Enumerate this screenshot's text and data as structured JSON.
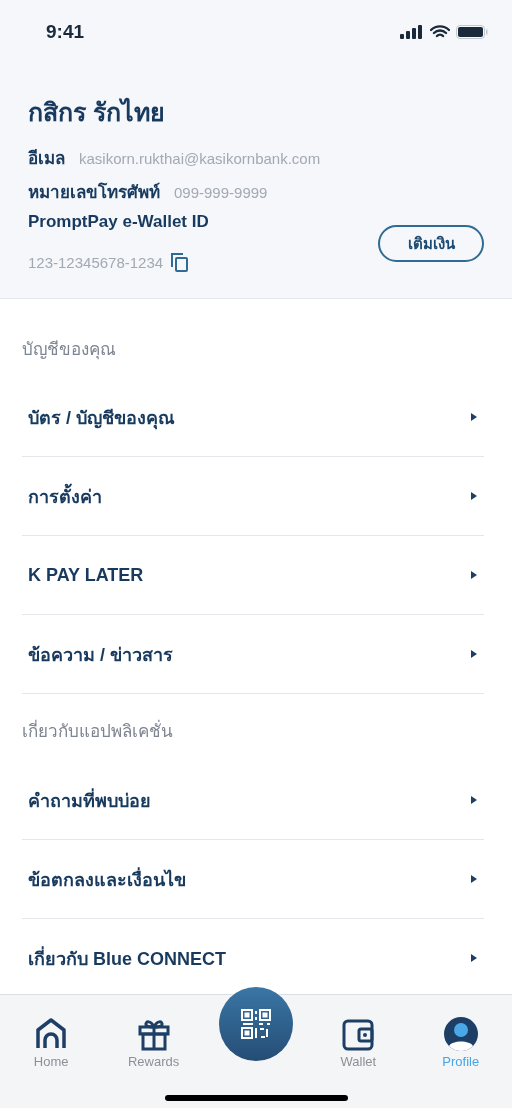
{
  "status_bar": {
    "time": "9:41"
  },
  "profile": {
    "name": "กสิกร รักไทย",
    "fields": [
      {
        "label": "อีเมล",
        "value": "kasikorn.rukthai@kasikornbank.com"
      },
      {
        "label": "หมายเลขโทรศัพท์",
        "value": "099-999-9999"
      }
    ],
    "wallet_label": "PromptPay e-Wallet ID",
    "wallet_id": "123-12345678-1234",
    "topup_button": "เติมเงิน"
  },
  "sections": [
    {
      "title": "บัญชีของคุณ",
      "items": [
        "บัตร / บัญชีของคุณ",
        "การตั้งค่า",
        "K PAY LATER",
        "ข้อความ / ข่าวสาร"
      ]
    },
    {
      "title": "เกี่ยวกับแอปพลิเคชั่น",
      "items": [
        "คำถามที่พบบ่อย",
        "ข้อตกลงและเงื่อนไข",
        "เกี่ยวกับ Blue CONNECT"
      ]
    }
  ],
  "tab_bar": [
    {
      "kind": "home",
      "label": "Home",
      "selected": false
    },
    {
      "kind": "rewards",
      "label": "Rewards",
      "selected": false
    },
    {
      "kind": "scan"
    },
    {
      "kind": "wallet",
      "label": "Wallet",
      "selected": false
    },
    {
      "kind": "profile",
      "label": "Profile",
      "selected": true
    }
  ]
}
